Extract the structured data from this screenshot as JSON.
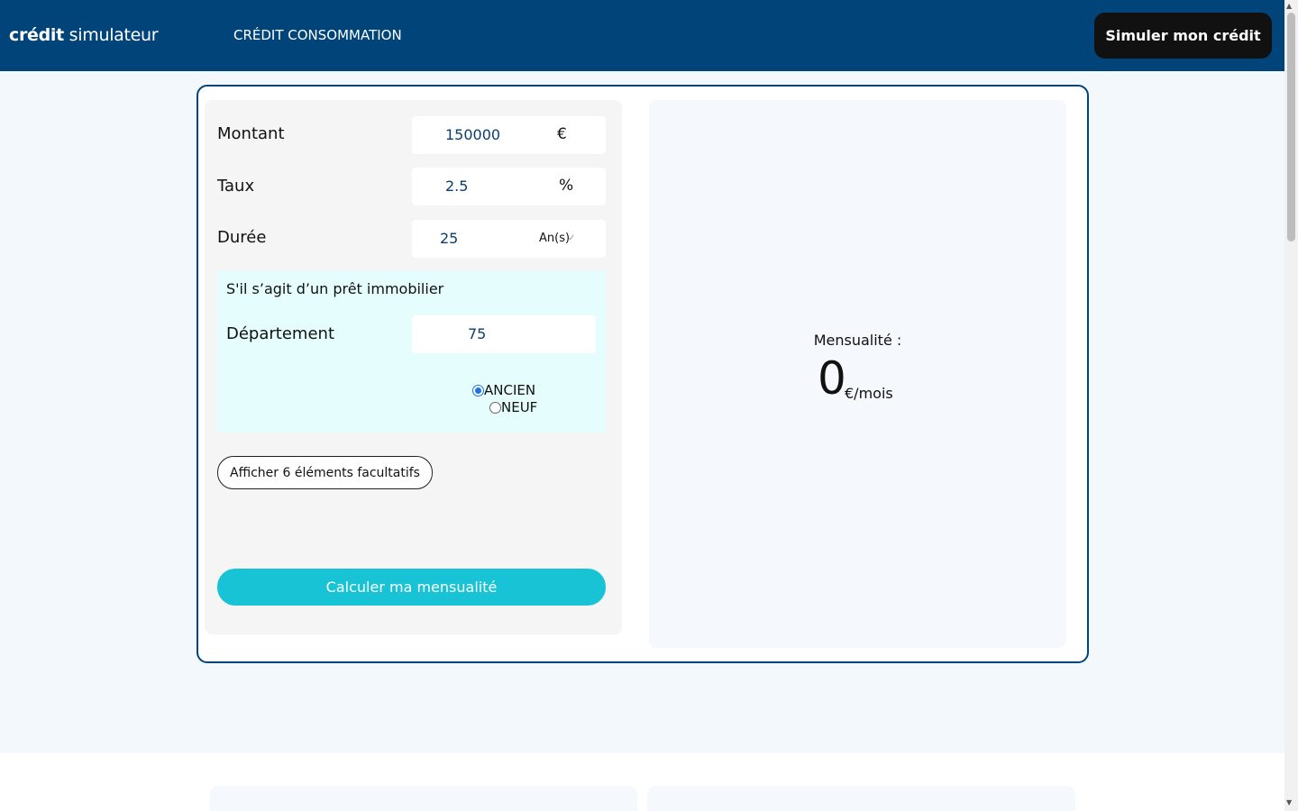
{
  "header": {
    "logo_bold": "crédit",
    "logo_regular": " simulateur",
    "nav_link": "CRÉDIT CONSOMMATION",
    "cta_label": "Simuler mon crédit"
  },
  "form": {
    "montant_label": "Montant",
    "montant_value": "150000",
    "montant_unit": "€",
    "taux_label": "Taux",
    "taux_value": "2.5",
    "taux_unit": "%",
    "duree_label": "Durée",
    "duree_value": "25",
    "duree_unit": "An(s)",
    "immo_title": "S'il s’agit d’un prêt immobilier",
    "departement_label": "Département",
    "departement_value": "75",
    "radio_ancien": "ANCIEN",
    "radio_neuf": "NEUF",
    "radio_selected": "ANCIEN",
    "optional_button": "Afficher 6 éléments facultatifs",
    "calc_button": "Calculer ma mensualité"
  },
  "result": {
    "label": "Mensualité :",
    "value": "0",
    "unit": "€/mois"
  },
  "colors": {
    "header_bg": "#00447a",
    "accent": "#17c3d4",
    "immo_bg": "#e5fdfd"
  },
  "icons": {
    "duree_dropdown": "chevron-down-icon"
  }
}
